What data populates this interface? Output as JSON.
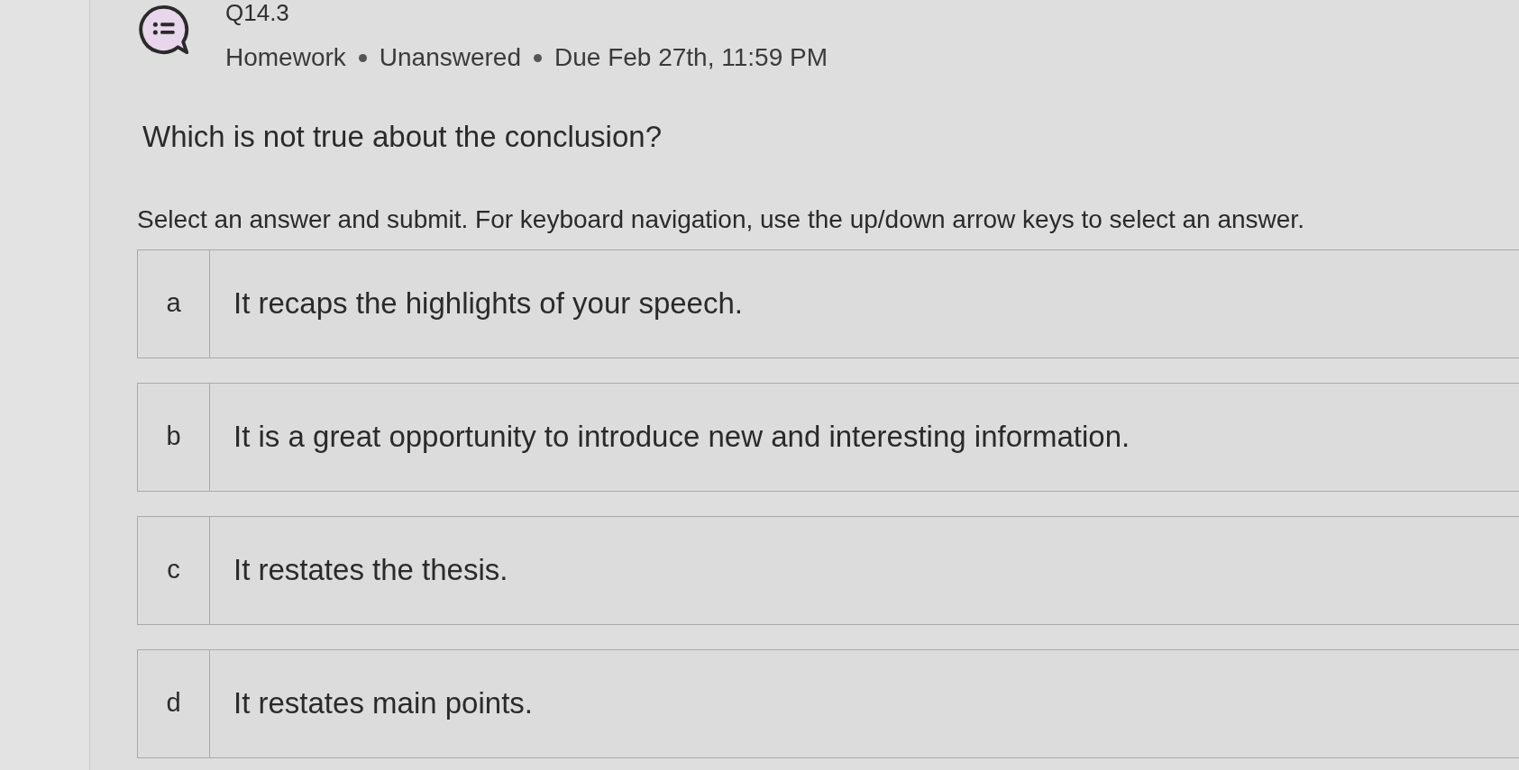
{
  "header": {
    "title": "Q14.3",
    "meta": [
      "Homework",
      "Unanswered",
      "Due Feb 27th, 11:59 PM"
    ]
  },
  "question": "Which is not true about the conclusion?",
  "instructions": "Select an answer and submit. For keyboard navigation, use the up/down arrow keys to select an answer.",
  "options": [
    {
      "letter": "a",
      "text": "It recaps the highlights of your speech.",
      "selected": false
    },
    {
      "letter": "b",
      "text": "It is a great opportunity to introduce new and interesting information.",
      "selected": false
    },
    {
      "letter": "c",
      "text": "It restates the thesis.",
      "selected": false
    },
    {
      "letter": "d",
      "text": "It restates main points.",
      "selected": false
    }
  ]
}
